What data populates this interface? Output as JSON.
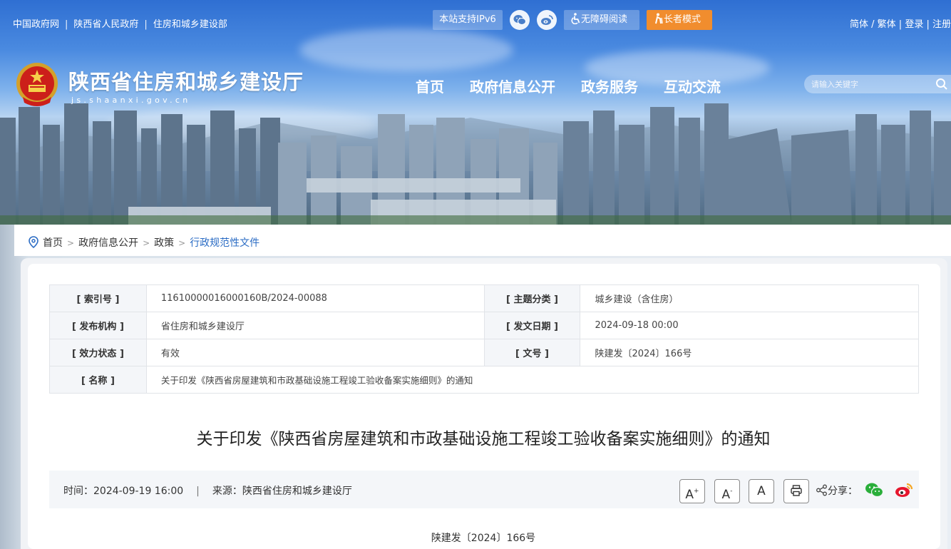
{
  "topbar": {
    "links": [
      "中国政府网",
      "陕西省人民政府",
      "住房和城乡建设部"
    ],
    "ipv6_label": "本站支持IPv6",
    "accessible_label": "无障碍阅读",
    "elder_label": "长者模式",
    "lang_simplified": "简体",
    "lang_traditional": "繁体",
    "login": "登录",
    "register": "注册"
  },
  "site": {
    "title": "陕西省住房和城乡建设厅",
    "domain": "js.shaanxi.gov.cn"
  },
  "nav": {
    "items": [
      "首页",
      "政府信息公开",
      "政务服务",
      "互动交流"
    ]
  },
  "search": {
    "placeholder": "请输入关键字"
  },
  "breadcrumb": {
    "items": [
      "首页",
      "政府信息公开",
      "政策"
    ],
    "current": "行政规范性文件"
  },
  "meta": {
    "index_label": "[ 索引号 ]",
    "index_value": "11610000016000160B/2024-00088",
    "topic_label": "[ 主题分类 ]",
    "topic_value": "城乡建设（含住房）",
    "org_label": "[ 发布机构 ]",
    "org_value": "省住房和城乡建设厅",
    "date_label": "[ 发文日期 ]",
    "date_value": "2024-09-18 00:00",
    "status_label": "[ 效力状态 ]",
    "status_value": "有效",
    "docno_label": "[ 文号 ]",
    "docno_value": "陕建发〔2024〕166号",
    "name_label": "[ 名称 ]",
    "name_value": "关于印发《陕西省房屋建筑和市政基础设施工程竣工验收备案实施细则》的通知"
  },
  "article": {
    "title": "关于印发《陕西省房屋建筑和市政基础设施工程竣工验收备案实施细则》的通知",
    "time_label": "时间：",
    "time_value": "2024-09-19 16:00",
    "divider": "|",
    "source_label": "来源：",
    "source_value": "陕西省住房和城乡建设厅",
    "font_large": "A",
    "font_small": "A",
    "font_reset": "A",
    "font_large_sup": "+",
    "font_small_sup": "-",
    "share_label": "分享：",
    "doc_number": "陕建发〔2024〕166号"
  },
  "colors": {
    "accent_blue": "#2b6cc4",
    "elder_orange": "#f18d2e",
    "status_green": "#2f9a3a"
  }
}
